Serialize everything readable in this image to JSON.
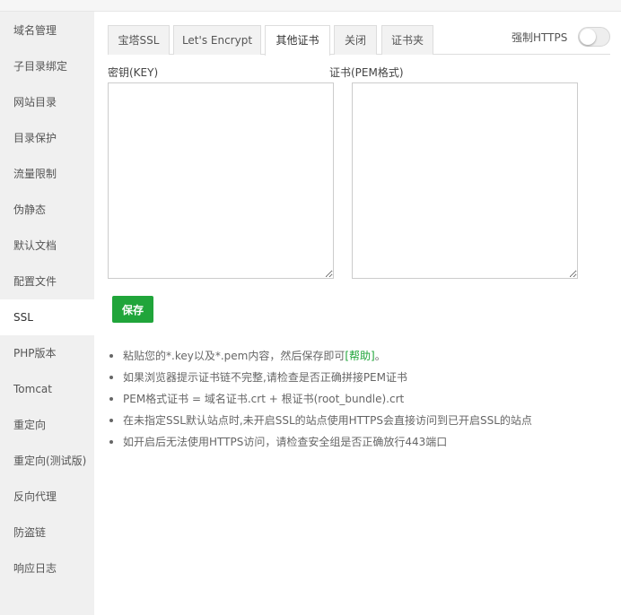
{
  "sidebar": {
    "items": [
      {
        "label": "域名管理"
      },
      {
        "label": "子目录绑定"
      },
      {
        "label": "网站目录"
      },
      {
        "label": "目录保护"
      },
      {
        "label": "流量限制"
      },
      {
        "label": "伪静态"
      },
      {
        "label": "默认文档"
      },
      {
        "label": "配置文件"
      },
      {
        "label": "SSL"
      },
      {
        "label": "PHP版本"
      },
      {
        "label": "Tomcat"
      },
      {
        "label": "重定向"
      },
      {
        "label": "重定向(测试版)"
      },
      {
        "label": "反向代理"
      },
      {
        "label": "防盗链"
      },
      {
        "label": "响应日志"
      }
    ],
    "active": "SSL"
  },
  "tabs": [
    {
      "label": "宝塔SSL"
    },
    {
      "label": "Let's Encrypt"
    },
    {
      "label": "其他证书"
    },
    {
      "label": "关闭"
    },
    {
      "label": "证书夹"
    }
  ],
  "active_tab": "其他证书",
  "force_https": {
    "label": "强制HTTPS",
    "enabled": false
  },
  "form": {
    "key_label": "密钥(KEY)",
    "key_value": "",
    "cert_label": "证书(PEM格式)",
    "cert_value": "",
    "save_label": "保存"
  },
  "tips": {
    "tip1_text": "粘贴您的*.key以及*.pem内容，然后保存即可",
    "tip1_link": "[帮助]",
    "tip1_end": "。",
    "tip2": "如果浏览器提示证书链不完整,请检查是否正确拼接PEM证书",
    "tip3": "PEM格式证书 = 域名证书.crt + 根证书(root_bundle).crt",
    "tip4": "在未指定SSL默认站点时,未开启SSL的站点使用HTTPS会直接访问到已开启SSL的站点",
    "tip5": "如开启后无法使用HTTPS访问，请检查安全组是否正确放行443端口"
  },
  "colors": {
    "accent": "#20a53a",
    "sidebar_bg": "#f0f0f0"
  }
}
